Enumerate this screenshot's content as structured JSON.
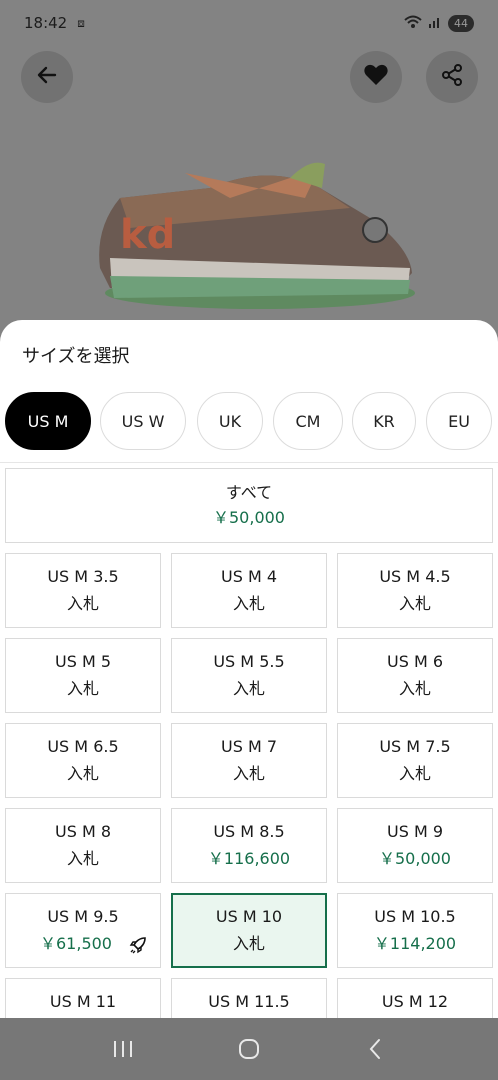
{
  "status_bar": {
    "time": "18:42",
    "battery": "44"
  },
  "sheet": {
    "title": "サイズを選択",
    "tabs": [
      {
        "label": "US M",
        "active": true
      },
      {
        "label": "US W",
        "active": false
      },
      {
        "label": "UK",
        "active": false
      },
      {
        "label": "CM",
        "active": false
      },
      {
        "label": "KR",
        "active": false
      },
      {
        "label": "EU",
        "active": false
      }
    ],
    "all": {
      "label": "すべて",
      "price": "￥50,000"
    },
    "sizes": [
      {
        "label": "US M 3.5",
        "value": "入札",
        "is_price": false
      },
      {
        "label": "US M 4",
        "value": "入札",
        "is_price": false
      },
      {
        "label": "US M 4.5",
        "value": "入札",
        "is_price": false
      },
      {
        "label": "US M 5",
        "value": "入札",
        "is_price": false
      },
      {
        "label": "US M 5.5",
        "value": "入札",
        "is_price": false
      },
      {
        "label": "US M 6",
        "value": "入札",
        "is_price": false
      },
      {
        "label": "US M 6.5",
        "value": "入札",
        "is_price": false
      },
      {
        "label": "US M 7",
        "value": "入札",
        "is_price": false
      },
      {
        "label": "US M 7.5",
        "value": "入札",
        "is_price": false
      },
      {
        "label": "US M 8",
        "value": "入札",
        "is_price": false
      },
      {
        "label": "US M 8.5",
        "value": "￥116,600",
        "is_price": true
      },
      {
        "label": "US M 9",
        "value": "￥50,000",
        "is_price": true
      },
      {
        "label": "US M 9.5",
        "value": "￥61,500",
        "is_price": true,
        "icon": "rocket-icon"
      },
      {
        "label": "US M 10",
        "value": "入札",
        "is_price": false,
        "selected": true
      },
      {
        "label": "US M 10.5",
        "value": "￥114,200",
        "is_price": true
      },
      {
        "label": "US M 11",
        "value": "",
        "is_price": false
      },
      {
        "label": "US M 11.5",
        "value": "",
        "is_price": false
      },
      {
        "label": "US M 12",
        "value": "",
        "is_price": false
      }
    ]
  },
  "colors": {
    "accent": "#166f4b",
    "selected_bg": "#eaf6ef"
  },
  "icons": [
    "back-arrow-icon",
    "heart-icon",
    "share-icon",
    "rocket-icon",
    "recents-icon",
    "home-icon",
    "back-icon"
  ]
}
